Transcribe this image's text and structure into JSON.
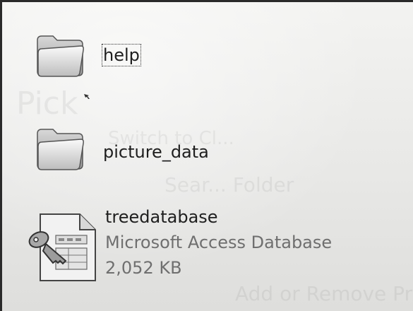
{
  "items": [
    {
      "name": "help",
      "selected": true,
      "icon": "folder-icon"
    },
    {
      "name": "picture_data",
      "selected": false,
      "icon": "folder-icon"
    },
    {
      "name": "treedatabase",
      "type": "Microsoft Access Database",
      "size": "2,052 KB",
      "icon": "access-database-icon"
    }
  ],
  "ghost_text": {
    "line1": "Pick",
    "line2": "Switch to Cl...",
    "line3": "Sear... Folder",
    "line4": "Add or Remove Pr"
  },
  "colors": {
    "background": "#e9e9e7",
    "text": "#1e1e1e",
    "subtext": "#6f6f6f",
    "frame": "#2a2a2a"
  }
}
